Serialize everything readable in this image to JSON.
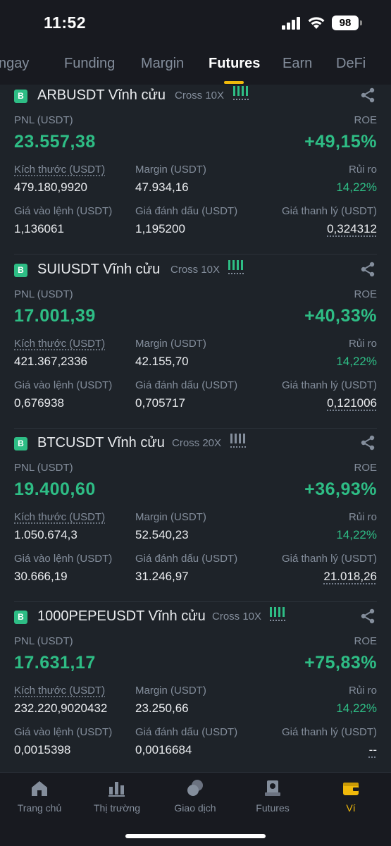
{
  "status": {
    "time": "11:52",
    "battery": "98"
  },
  "tabs": [
    {
      "label": "ngay"
    },
    {
      "label": "Funding"
    },
    {
      "label": "Margin"
    },
    {
      "label": "Futures"
    },
    {
      "label": "Earn"
    },
    {
      "label": "DeFi"
    }
  ],
  "labels": {
    "pnl": "PNL (USDT)",
    "roe": "ROE",
    "size": "Kích thước (USDT)",
    "margin": "Margin (USDT)",
    "risk": "Rủi ro",
    "entry": "Giá vào lệnh (USDT)",
    "mark": "Giá đánh dấu (USDT)",
    "liq": "Giá thanh lý (USDT)"
  },
  "positions": [
    {
      "badge": "B",
      "symbol": "ARBUSDT Vĩnh cửu",
      "mode": "Cross 10X",
      "pnl": "23.557,38",
      "roe": "+49,15%",
      "size": "479.180,9920",
      "margin": "47.934,16",
      "risk": "14,22%",
      "entry": "1,136061",
      "mark": "1,195200",
      "liq": "0,324312"
    },
    {
      "badge": "B",
      "symbol": "SUIUSDT Vĩnh cửu",
      "mode": "Cross 10X",
      "pnl": "17.001,39",
      "roe": "+40,33%",
      "size": "421.367,2336",
      "margin": "42.155,70",
      "risk": "14,22%",
      "entry": "0,676938",
      "mark": "0,705717",
      "liq": "0,121006"
    },
    {
      "badge": "B",
      "symbol": "BTCUSDT Vĩnh cửu",
      "mode": "Cross 20X",
      "pnl": "19.400,60",
      "roe": "+36,93%",
      "size": "1.050.674,3",
      "margin": "52.540,23",
      "risk": "14,22%",
      "entry": "30.666,19",
      "mark": "31.246,97",
      "liq": "21.018,26"
    },
    {
      "badge": "B",
      "symbol": "1000PEPEUSDT Vĩnh cửu",
      "mode": "Cross 10X",
      "pnl": "17.631,17",
      "roe": "+75,83%",
      "size": "232.220,9020432",
      "margin": "23.250,66",
      "risk": "14,22%",
      "entry": "0,0015398",
      "mark": "0,0016684",
      "liq": "--"
    }
  ],
  "bottom_nav": [
    {
      "label": "Trang chủ",
      "icon": "home-icon"
    },
    {
      "label": "Thị trường",
      "icon": "market-icon"
    },
    {
      "label": "Giao dịch",
      "icon": "trade-icon"
    },
    {
      "label": "Futures",
      "icon": "futures-icon"
    },
    {
      "label": "Ví",
      "icon": "wallet-icon"
    }
  ],
  "colors": {
    "profit": "#2ebd85",
    "accent": "#f0b90b",
    "background": "#1e2329",
    "muted": "#848e9c"
  }
}
